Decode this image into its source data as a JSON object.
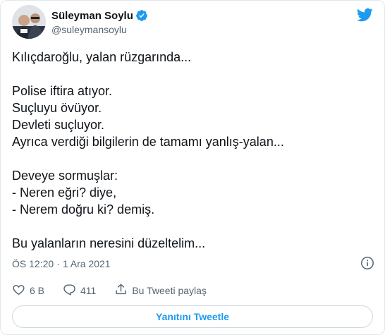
{
  "tweet": {
    "author": {
      "display_name": "Süleyman Soylu",
      "username": "@suleymansoylu",
      "verified": true
    },
    "lines": [
      "Kılıçdaroğlu, yalan rüzgarında...",
      "",
      "Polise iftira atıyor.",
      "Suçluyu övüyor.",
      "Devleti suçluyor.",
      "Ayrıca verdiği bilgilerin de tamamı yanlış-yalan...",
      "",
      "Deveye sormuşlar:",
      "- Neren eğri? diye,",
      "- Nerem doğru ki? demiş.",
      "",
      "Bu yalanların neresini düzeltelim..."
    ],
    "time": "ÖS 12:20",
    "date": "1 Ara 2021",
    "date_separator": "·"
  },
  "actions": {
    "like_count": "6 B",
    "reply_count": "411",
    "share_label": "Bu Tweeti paylaş"
  },
  "reply_button": {
    "label": "Yanıtını Tweetle"
  },
  "icons": {
    "verified": "verified-badge-icon",
    "brand": "twitter-bird-icon",
    "info": "info-icon",
    "like": "heart-icon",
    "reply": "speech-bubble-icon",
    "share": "share-upload-icon"
  },
  "colors": {
    "accent": "#1d9bf0",
    "text": "#0f1419",
    "secondary": "#536471",
    "border": "#cfd9de"
  }
}
